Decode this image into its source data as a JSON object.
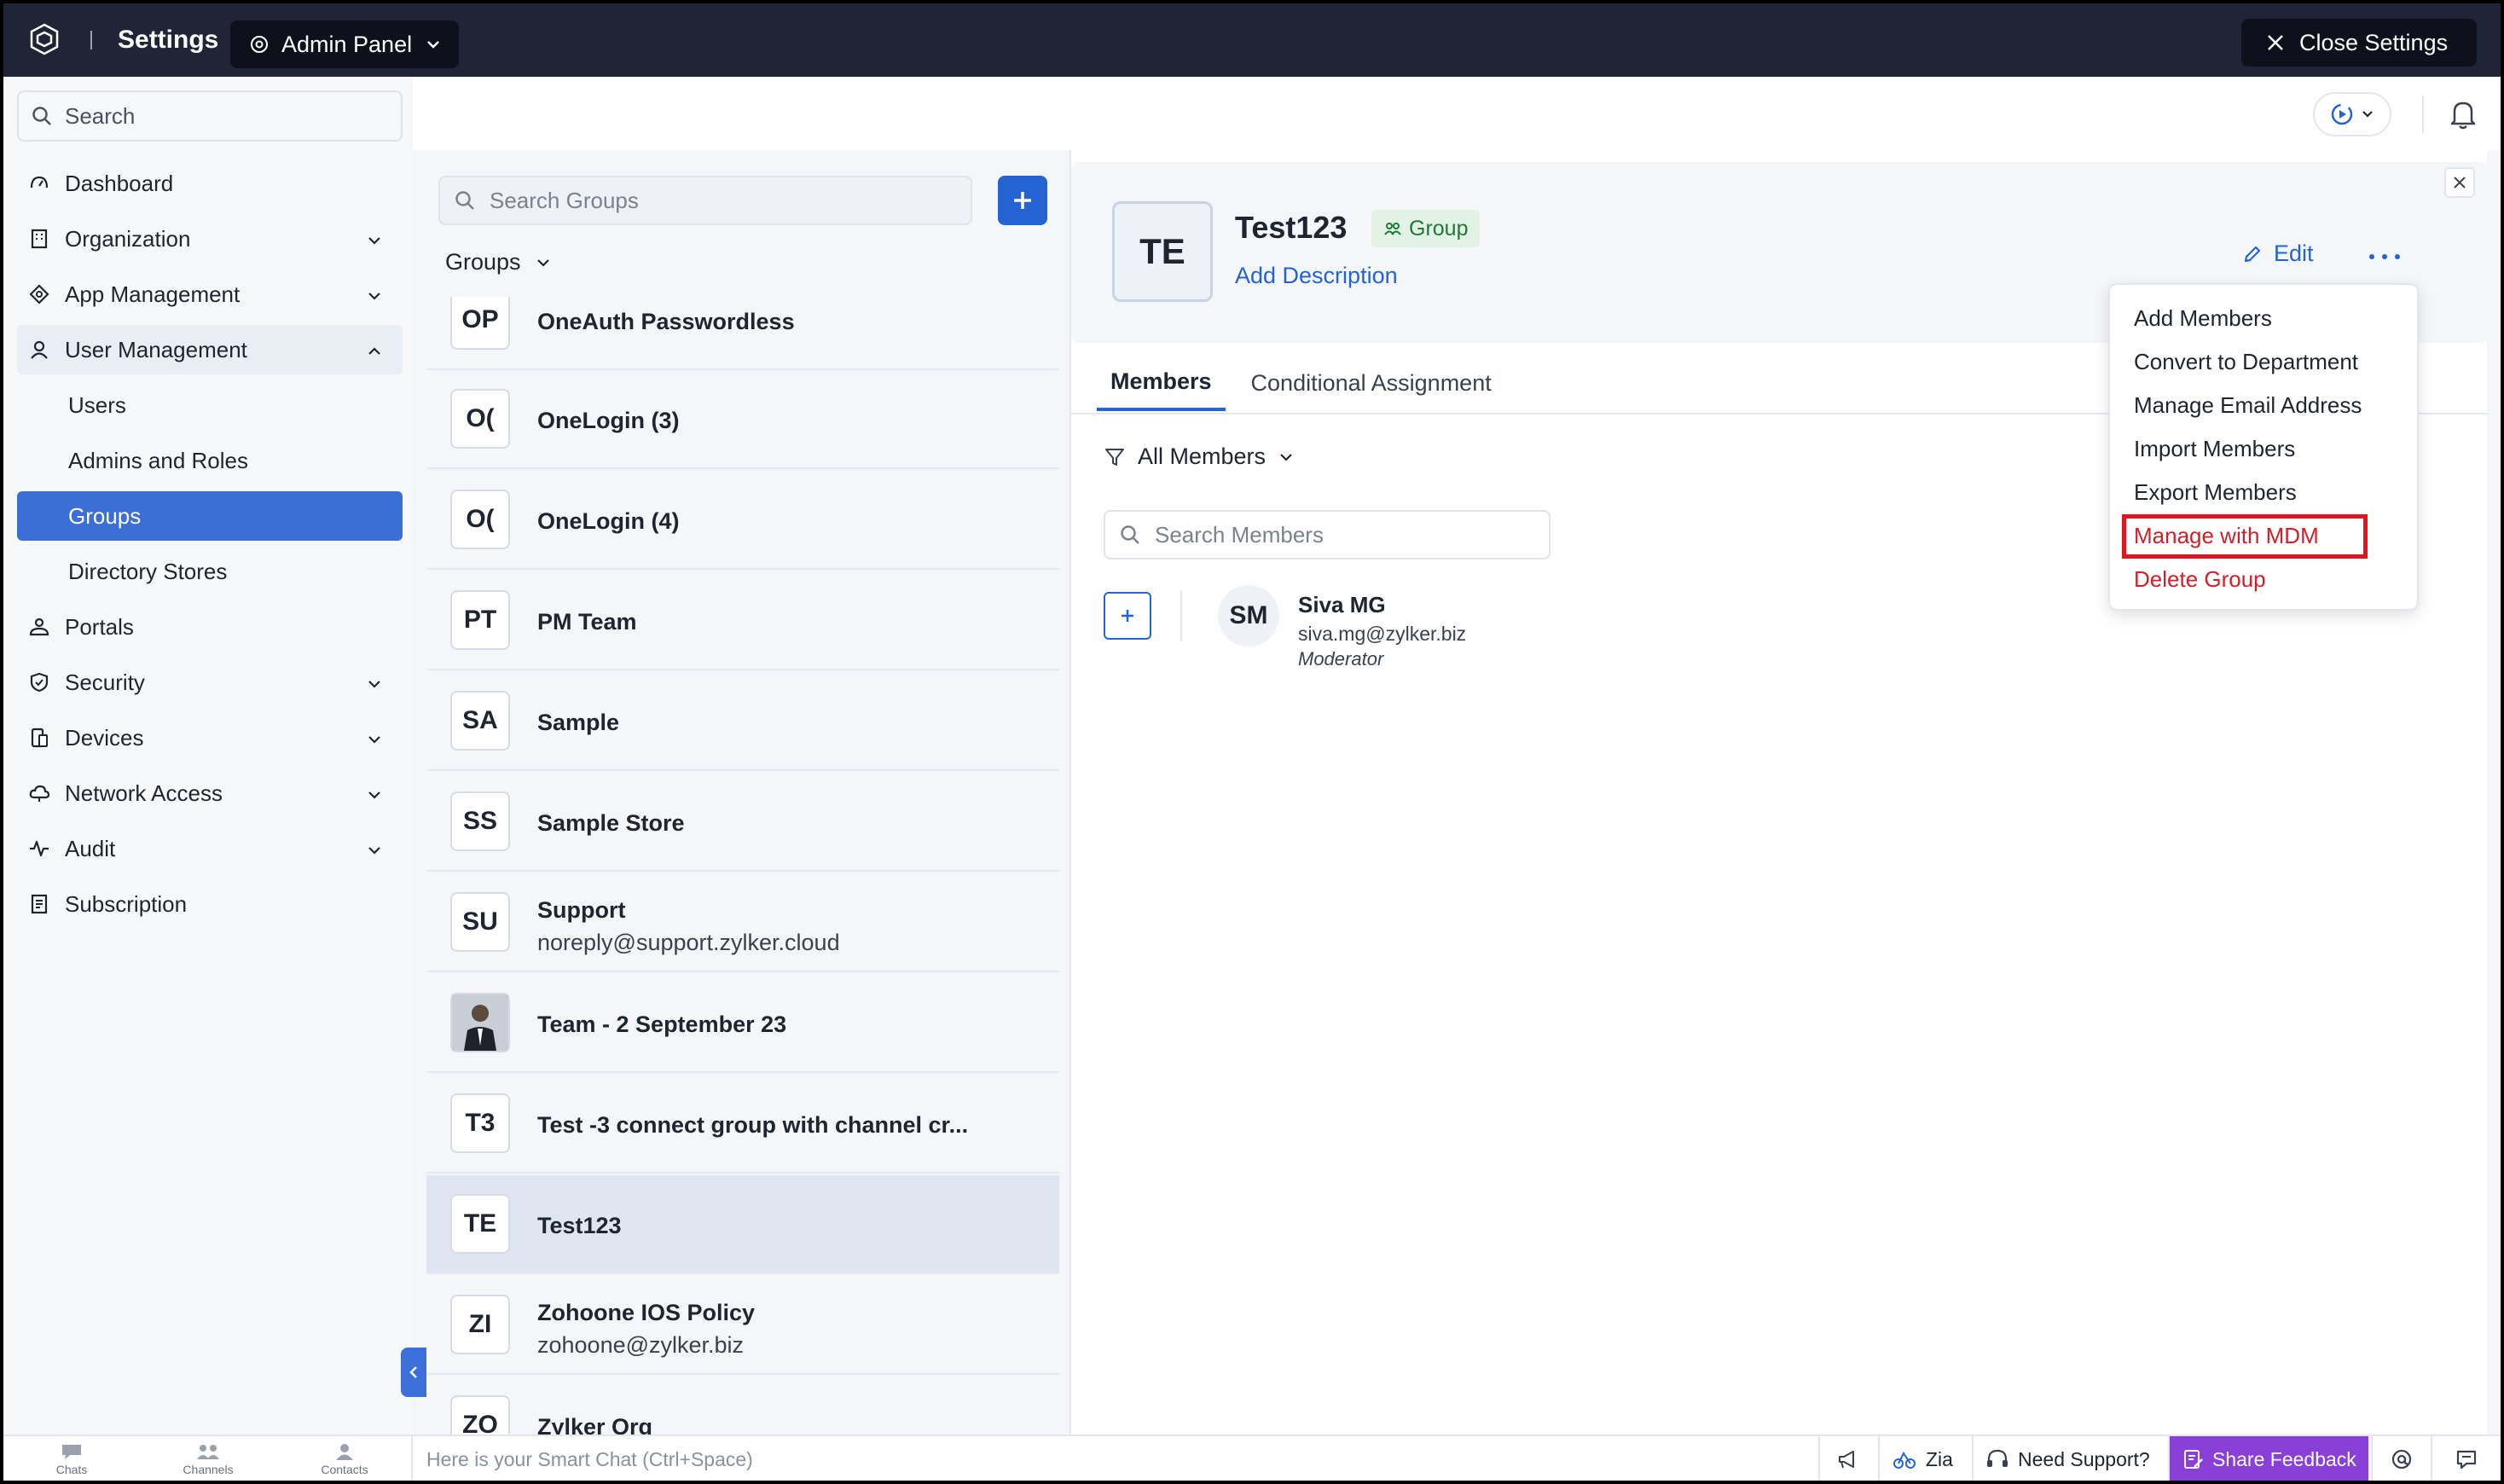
{
  "topbar": {
    "title": "Settings",
    "org_selector": "Admin Panel",
    "close_label": "Close Settings"
  },
  "sidebar": {
    "search_placeholder": "Search",
    "items": [
      {
        "label": "Dashboard",
        "icon": "dashboard-icon",
        "expandable": false
      },
      {
        "label": "Organization",
        "icon": "organization-icon",
        "expandable": true
      },
      {
        "label": "App Management",
        "icon": "app-management-icon",
        "expandable": true
      },
      {
        "label": "User Management",
        "icon": "user-icon",
        "expandable": true,
        "expanded": true
      },
      {
        "label": "Users",
        "sub": true
      },
      {
        "label": "Admins and Roles",
        "sub": true
      },
      {
        "label": "Groups",
        "sub": true,
        "selected": true
      },
      {
        "label": "Directory Stores",
        "sub": true
      },
      {
        "label": "Portals",
        "icon": "portals-icon",
        "expandable": false
      },
      {
        "label": "Security",
        "icon": "shield-icon",
        "expandable": true
      },
      {
        "label": "Devices",
        "icon": "devices-icon",
        "expandable": true
      },
      {
        "label": "Network Access",
        "icon": "cloud-icon",
        "expandable": true
      },
      {
        "label": "Audit",
        "icon": "pulse-icon",
        "expandable": true
      },
      {
        "label": "Subscription",
        "icon": "receipt-icon",
        "expandable": false
      }
    ]
  },
  "groups_panel": {
    "search_placeholder": "Search Groups",
    "filter_label": "Groups",
    "rows": [
      {
        "initials": "OP",
        "name": "OneAuth Passwordless",
        "sub": ""
      },
      {
        "initials": "O(",
        "name": "OneLogin (3)",
        "sub": ""
      },
      {
        "initials": "O(",
        "name": "OneLogin (4)",
        "sub": ""
      },
      {
        "initials": "PT",
        "name": "PM Team",
        "sub": ""
      },
      {
        "initials": "SA",
        "name": "Sample",
        "sub": ""
      },
      {
        "initials": "SS",
        "name": "Sample Store",
        "sub": ""
      },
      {
        "initials": "SU",
        "name": "Support",
        "sub": "noreply@support.zylker.cloud"
      },
      {
        "initials": "",
        "name": "Team - 2 September 23",
        "sub": "",
        "photo": true
      },
      {
        "initials": "T3",
        "name": "Test -3 connect group with channel cr...",
        "sub": ""
      },
      {
        "initials": "TE",
        "name": "Test123",
        "sub": "",
        "selected": true
      },
      {
        "initials": "ZI",
        "name": "Zohoone IOS Policy",
        "sub": "zohoone@zylker.biz"
      },
      {
        "initials": "ZO",
        "name": "Zylker Org",
        "sub": ""
      }
    ]
  },
  "detail": {
    "initials": "TE",
    "title": "Test123",
    "badge": "Group",
    "add_description": "Add Description",
    "edit_label": "Edit",
    "tabs": [
      "Members",
      "Conditional Assignment"
    ],
    "filter_label": "All Members",
    "search_placeholder": "Search Members",
    "member": {
      "initials": "SM",
      "name": "Siva MG",
      "email": "siva.mg@zylker.biz",
      "role": "Moderator"
    }
  },
  "menu": {
    "items": [
      {
        "label": "Add Members",
        "danger": false
      },
      {
        "label": "Convert to Department",
        "danger": false
      },
      {
        "label": "Manage Email Address",
        "danger": false
      },
      {
        "label": "Import Members",
        "danger": false
      },
      {
        "label": "Export Members",
        "danger": false
      },
      {
        "label": "Manage with MDM",
        "danger": true,
        "highlighted": true
      },
      {
        "label": "Delete Group",
        "danger": true
      }
    ]
  },
  "bottombar": {
    "tabs": [
      "Chats",
      "Channels",
      "Contacts"
    ],
    "chat_placeholder": "Here is your Smart Chat (Ctrl+Space)",
    "zia": "Zia",
    "support": "Need Support?",
    "feedback": "Share Feedback"
  },
  "colors": {
    "topbar": "#1f2436",
    "accent": "#2364d2",
    "selected_nav": "#3b6fd6",
    "danger": "#d0202a",
    "highlight_box": "#e0141e"
  }
}
